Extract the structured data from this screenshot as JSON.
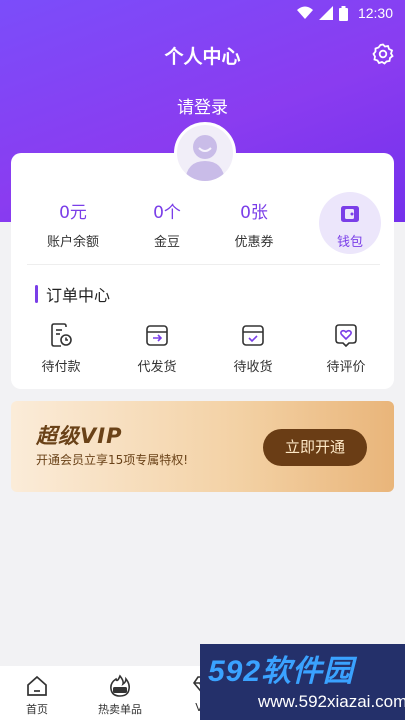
{
  "status_bar": {
    "time": "12:30"
  },
  "header": {
    "title": "个人中心",
    "login_text": "请登录"
  },
  "stats": [
    {
      "value": "0元",
      "label": "账户余额"
    },
    {
      "value": "0个",
      "label": "金豆"
    },
    {
      "value": "0张",
      "label": "优惠券"
    }
  ],
  "wallet": {
    "label": "钱包"
  },
  "orders": {
    "title": "订单中心",
    "items": [
      {
        "label": "待付款",
        "icon": "pending-payment-icon"
      },
      {
        "label": "代发货",
        "icon": "to-ship-icon"
      },
      {
        "label": "待收货",
        "icon": "to-receive-icon"
      },
      {
        "label": "待评价",
        "icon": "to-review-icon"
      }
    ]
  },
  "vip": {
    "title": "超级VIP",
    "subtitle": "开通会员立享15项专属特权!",
    "button": "立即开通"
  },
  "tabbar": [
    {
      "label": "首页",
      "icon": "home-icon"
    },
    {
      "label": "热卖单品",
      "icon": "hot-icon"
    },
    {
      "label": "VIP",
      "icon": "vip-diamond-icon"
    }
  ],
  "watermark": {
    "brand": "592软件园",
    "url": "www.592xiazai.com"
  },
  "colors": {
    "accent": "#7a3ee8",
    "header": "#7b4dfa",
    "vip_button": "#6a3d15"
  }
}
